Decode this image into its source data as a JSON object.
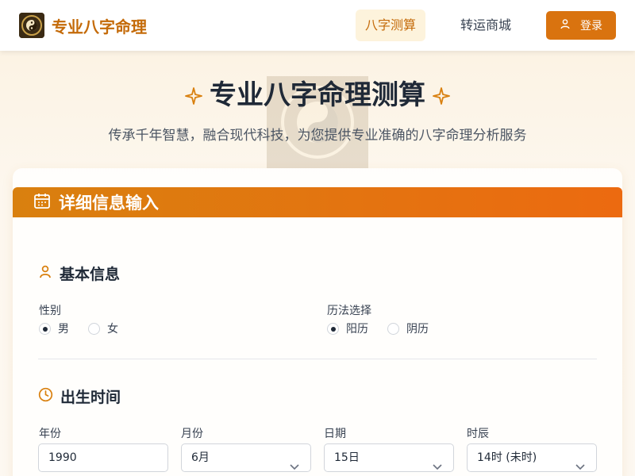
{
  "header": {
    "brand": "专业八字命理",
    "nav": [
      {
        "label": "八字测算",
        "active": true
      },
      {
        "label": "转运商城",
        "active": false
      }
    ],
    "login_label": "登录"
  },
  "hero": {
    "title": "专业八字命理测算",
    "subtitle": "传承千年智慧，融合现代科技，为您提供专业准确的八字命理分析服务"
  },
  "card": {
    "title": "详细信息输入",
    "basic": {
      "title": "基本信息",
      "gender_label": "性别",
      "gender_options": [
        {
          "label": "男",
          "checked": true
        },
        {
          "label": "女",
          "checked": false
        }
      ],
      "calendar_label": "历法选择",
      "calendar_options": [
        {
          "label": "阳历",
          "checked": true
        },
        {
          "label": "阴历",
          "checked": false
        }
      ]
    },
    "birth": {
      "title": "出生时间",
      "fields": [
        {
          "label": "年份",
          "value": "1990"
        },
        {
          "label": "月份",
          "value": "6月"
        },
        {
          "label": "日期",
          "value": "15日"
        },
        {
          "label": "时辰",
          "value": "14时 (未时)"
        }
      ]
    }
  },
  "colors": {
    "accent": "#d9730f",
    "brand_text": "#c46a08",
    "header_gradient_start": "#d9800f",
    "header_gradient_end": "#ec6a10"
  },
  "icons": [
    "taiji-logo-icon",
    "user-icon",
    "sparkle-icon",
    "calendar-icon",
    "clock-icon",
    "chevron-down-icon"
  ]
}
